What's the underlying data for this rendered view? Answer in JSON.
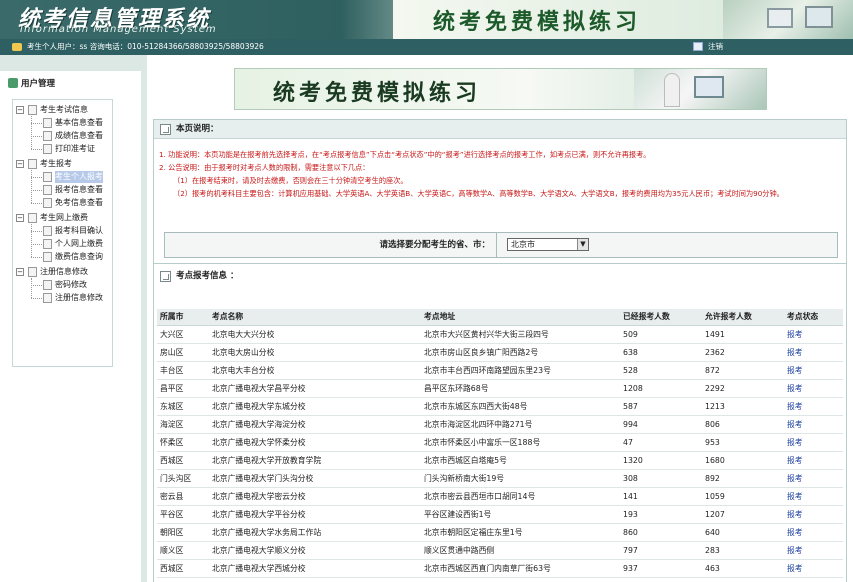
{
  "header": {
    "system_title": "统考信息管理系统",
    "system_subtitle": "Information Management System",
    "banner_title": "统考免费模拟练习"
  },
  "infobar": {
    "user_text": "考生个人用户：ss   咨询电话：010-51284366/58803925/58803926",
    "logout_label": "注销"
  },
  "sidebar": {
    "heading": "用户管理",
    "tree": [
      {
        "label": "考生考试信息",
        "children": [
          "基本信息查看",
          "成绩信息查看",
          "打印准考证"
        ]
      },
      {
        "label": "考生报考",
        "children": [
          "考生个人报考",
          "报考信息查看",
          "免考信息查看"
        ]
      },
      {
        "label": "考生网上缴费",
        "children": [
          "报考科目确认",
          "个人网上缴费",
          "缴费信息查询"
        ]
      },
      {
        "label": "注册信息修改",
        "children": [
          "密码修改",
          "注册信息修改"
        ]
      }
    ],
    "selected_item": "考生个人报考"
  },
  "main": {
    "banner_title": "统考免费模拟练习",
    "description": {
      "title": "本页说明：",
      "lines": [
        "1. 功能说明：本页功能是在报考前先选择考点，在“考点报考信息”下点击“考点状态”中的“报考”进行选择考点的报考工作，如考点已满，则不允许再报考。",
        "2. 公告说明：由于报考时对考点人数的限制，需要注意以下几点：",
        "（1）在报考结束时，请及时去缴费，否则会在三十分钟清空考生的座次。",
        "（2）报考的机考科目主要包含：计算机应用基础、大学英语A、大学英语B、大学英语C，高等数学A、高等数学B、大学语文A、大学语文B，报考的费用均为35元人民币；考试时间为90分钟。"
      ],
      "select_label": "请选择要分配考生的省、市：",
      "select_value": "北京市"
    },
    "sites": {
      "title": "考点报考信息 ：",
      "columns": [
        "所属市",
        "考点名称",
        "考点地址",
        "已经报考人数",
        "允许报考人数",
        "考点状态"
      ],
      "rows": [
        [
          "大兴区",
          "北京电大大兴分校",
          "北京市大兴区黄村兴华大街三段四号",
          "509",
          "1491",
          "报考"
        ],
        [
          "房山区",
          "北京电大房山分校",
          "北京市房山区良乡镇广阳西路2号",
          "638",
          "2362",
          "报考"
        ],
        [
          "丰台区",
          "北京电大丰台分校",
          "北京市丰台西四环南路望园东里23号",
          "528",
          "872",
          "报考"
        ],
        [
          "昌平区",
          "北京广播电视大学昌平分校",
          "昌平区东环路68号",
          "1208",
          "2292",
          "报考"
        ],
        [
          "东城区",
          "北京广播电视大学东城分校",
          "北京市东城区东四西大街48号",
          "587",
          "1213",
          "报考"
        ],
        [
          "海淀区",
          "北京广播电视大学海淀分校",
          "北京市海淀区北四环中路271号",
          "994",
          "806",
          "报考"
        ],
        [
          "怀柔区",
          "北京广播电视大学怀柔分校",
          "北京市怀柔区小中富乐一区188号",
          "47",
          "953",
          "报考"
        ],
        [
          "西城区",
          "北京广播电视大学开放教育学院",
          "北京市西城区白塔庵5号",
          "1320",
          "1680",
          "报考"
        ],
        [
          "门头沟区",
          "北京广播电视大学门头沟分校",
          "门头沟新桥南大街19号",
          "308",
          "892",
          "报考"
        ],
        [
          "密云县",
          "北京广播电视大学密云分校",
          "北京市密云县西垣市口胡同14号",
          "141",
          "1059",
          "报考"
        ],
        [
          "平谷区",
          "北京广播电视大学平谷分校",
          "平谷区建设西街1号",
          "193",
          "1207",
          "报考"
        ],
        [
          "朝阳区",
          "北京广播电视大学水务局工作站",
          "北京市朝阳区定福庄东里1号",
          "860",
          "640",
          "报考"
        ],
        [
          "顺义区",
          "北京广播电视大学顺义分校",
          "顺义区贯通中路西侧",
          "797",
          "283",
          "报考"
        ],
        [
          "西城区",
          "北京广播电视大学西城分校",
          "北京市西城区西直门内南草厂街63号",
          "937",
          "463",
          "报考"
        ]
      ]
    }
  }
}
